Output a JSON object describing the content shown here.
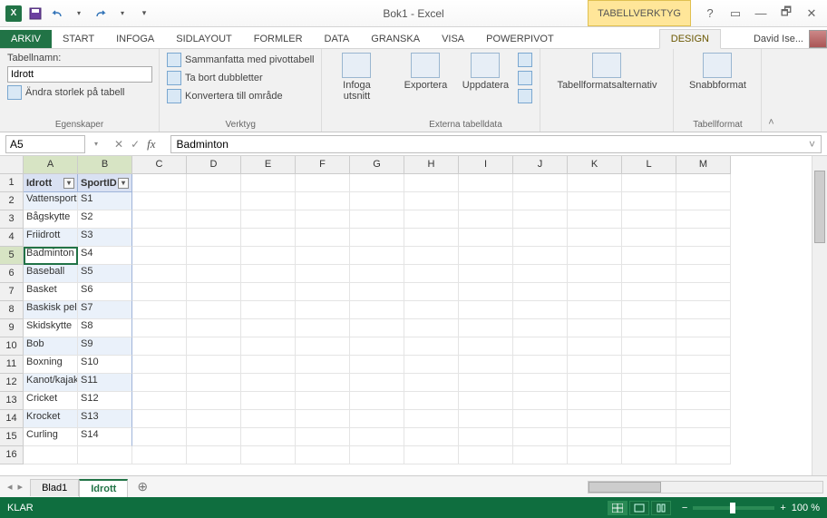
{
  "app": {
    "title": "Bok1 - Excel",
    "contextual_tab_group": "TABELLVERKTYG"
  },
  "account": {
    "name": "David Ise..."
  },
  "window": {
    "help": "?",
    "ribbon_opts": "▭",
    "minimize": "—",
    "restore": "🗗",
    "close": "✕"
  },
  "qat": {
    "logo": "X",
    "undo_dd": "▾",
    "redo_dd": "▾",
    "customize": "▾"
  },
  "tabs": {
    "file": "ARKIV",
    "home": "START",
    "insert": "INFOGA",
    "layout": "SIDLAYOUT",
    "formulas": "FORMLER",
    "data": "DATA",
    "review": "GRANSKA",
    "view": "VISA",
    "powerpivot": "POWERPIVOT",
    "design": "DESIGN"
  },
  "ribbon": {
    "props": {
      "title": "Egenskaper",
      "name_label": "Tabellnamn:",
      "name_value": "Idrott",
      "resize": "Ändra storlek på tabell"
    },
    "tools": {
      "title": "Verktyg",
      "pivot": "Sammanfatta med pivottabell",
      "dedup": "Ta bort dubbletter",
      "convert": "Konvertera till område"
    },
    "slicer": {
      "label": "Infoga utsnitt"
    },
    "external": {
      "title": "Externa tabelldata",
      "export": "Exportera",
      "refresh": "Uppdatera"
    },
    "styleopts": {
      "title": "Tabellformatsalternativ",
      "label": "Tabellformatsalternativ"
    },
    "styles": {
      "title": "Tabellformat",
      "quick": "Snabbformat"
    },
    "collapse": "˄"
  },
  "namebox": {
    "value": "A5"
  },
  "formula": {
    "cancel": "✕",
    "confirm": "✓",
    "fx": "fx",
    "value": "Badminton",
    "expand": "˅"
  },
  "columns": [
    "A",
    "B",
    "C",
    "D",
    "E",
    "F",
    "G",
    "H",
    "I",
    "J",
    "K",
    "L",
    "M"
  ],
  "table": {
    "headers": {
      "c1": "Idrott",
      "c2": "SportID"
    },
    "filter_glyph": "▾",
    "rows": [
      {
        "n": "1"
      },
      {
        "n": "2",
        "c1": "Vattensporter",
        "c2": "S1"
      },
      {
        "n": "3",
        "c1": "Bågskytte",
        "c2": "S2"
      },
      {
        "n": "4",
        "c1": "Friidrott",
        "c2": "S3"
      },
      {
        "n": "5",
        "c1": "Badminton",
        "c2": "S4"
      },
      {
        "n": "6",
        "c1": "Baseball",
        "c2": "S5"
      },
      {
        "n": "7",
        "c1": "Basket",
        "c2": "S6"
      },
      {
        "n": "8",
        "c1": "Baskisk pelota",
        "c2": "S7"
      },
      {
        "n": "9",
        "c1": "Skidskytte",
        "c2": "S8"
      },
      {
        "n": "10",
        "c1": "Bob",
        "c2": "S9"
      },
      {
        "n": "11",
        "c1": "Boxning",
        "c2": "S10"
      },
      {
        "n": "12",
        "c1": "Kanot/kajak",
        "c2": "S11"
      },
      {
        "n": "13",
        "c1": "Cricket",
        "c2": "S12"
      },
      {
        "n": "14",
        "c1": "Krocket",
        "c2": "S13"
      },
      {
        "n": "15",
        "c1": "Curling",
        "c2": "S14"
      }
    ]
  },
  "sheets": {
    "nav_prev": "◂",
    "nav_next": "▸",
    "s1": "Blad1",
    "s2": "Idrott",
    "add": "⊕"
  },
  "status": {
    "ready": "KLAR",
    "zoom": "100 %",
    "minus": "−",
    "plus": "+"
  }
}
